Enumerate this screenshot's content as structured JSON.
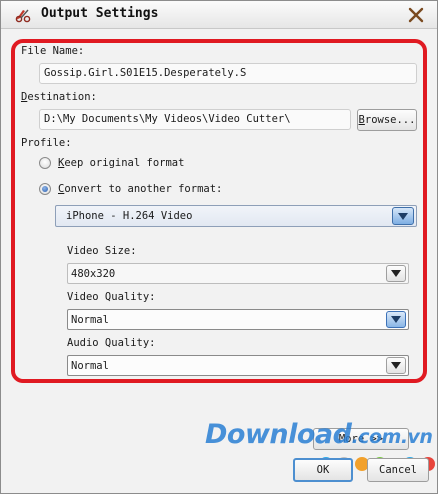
{
  "window": {
    "title": "Output Settings",
    "app_icon": "video-cutter-app-icon",
    "close_icon": "close-x-icon",
    "highlight_color": "#e01a22"
  },
  "file_name": {
    "label": "File Name:",
    "value": "Gossip.Girl.S01E15.Desperately.S"
  },
  "destination": {
    "label_pre": "",
    "label_underlined": "D",
    "label_post": "estination:",
    "value": "D:\\My Documents\\My Videos\\Video Cutter\\",
    "browse_pre": "",
    "browse_underlined": "B",
    "browse_post": "rowse..."
  },
  "profile": {
    "label": "Profile:",
    "keep_original": {
      "pre": "",
      "underlined": "K",
      "post": "eep original format",
      "checked": false
    },
    "convert": {
      "pre": "",
      "underlined": "C",
      "post": "onvert to another format:",
      "checked": true
    },
    "format_select": "iPhone - H.264 Video"
  },
  "video_size": {
    "label": "Video Size:",
    "value": "480x320"
  },
  "video_quality": {
    "label": "Video Quality:",
    "value": "Normal"
  },
  "audio_quality": {
    "label": "Audio Quality:",
    "value": "Normal"
  },
  "buttons": {
    "more": "More >>",
    "ok": "OK",
    "cancel": "Cancel"
  },
  "watermark": {
    "text": "Download",
    "suffix": ".com.vn",
    "dot_colors": [
      "#2fa9e8",
      "#bdbdbd",
      "#f2a12c",
      "#7ac943",
      "#2fa9e8",
      "#e8453c"
    ]
  },
  "colors": {
    "accent_blue": "#2a5fb0",
    "dialog_bg": "#f2f2f2"
  }
}
